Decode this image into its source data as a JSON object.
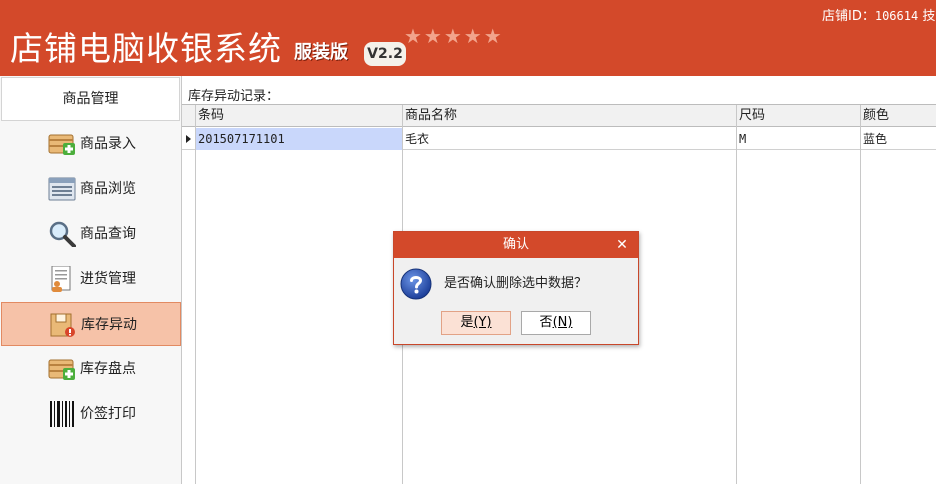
{
  "header": {
    "title": "店铺电脑收银系统",
    "edition": "服装版",
    "version": "V2.2",
    "stars": "★★★★★",
    "store_id_label": "店铺ID：",
    "store_id_value": "106614",
    "store_id_trailing": "技"
  },
  "sidebar": {
    "title": "商品管理",
    "items": [
      {
        "label": "商品录入",
        "icon": "product-add-icon"
      },
      {
        "label": "商品浏览",
        "icon": "product-list-icon"
      },
      {
        "label": "商品查询",
        "icon": "magnifier-icon"
      },
      {
        "label": "进货管理",
        "icon": "document-user-icon"
      },
      {
        "label": "库存异动",
        "icon": "inventory-change-icon"
      },
      {
        "label": "库存盘点",
        "icon": "inventory-count-icon"
      },
      {
        "label": "价签打印",
        "icon": "barcode-icon"
      }
    ],
    "active_index": 4
  },
  "main": {
    "section_title": "库存异动记录：",
    "columns": [
      "条码",
      "商品名称",
      "尺码",
      "颜色"
    ],
    "rows": [
      [
        "201507171101",
        "毛衣",
        "M",
        "蓝色"
      ]
    ]
  },
  "dialog": {
    "title": "确认",
    "message": "是否确认删除选中数据？",
    "yes_text": "是",
    "yes_accel": "(Y)",
    "no_text": "否",
    "no_accel": "(N)",
    "close_glyph": "✕"
  },
  "colors": {
    "brand": "#d3492a",
    "active_item_bg": "#f6c2a8",
    "selected_cell_bg": "#c9d7fb"
  }
}
